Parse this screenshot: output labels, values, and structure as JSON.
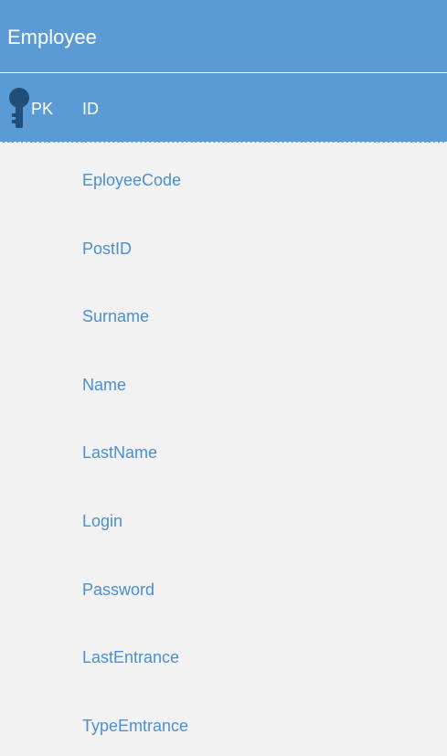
{
  "entity": {
    "title": "Employee",
    "primary_key": {
      "badge": "PK",
      "field": "ID",
      "icon": "key-icon"
    },
    "attributes": [
      "EployeeCode",
      "PostID",
      "Surname",
      "Name",
      "LastName",
      "Login",
      "Password",
      "LastEntrance",
      "TypeEmtrance"
    ]
  },
  "colors": {
    "header_bg": "#5b9bd5",
    "body_bg": "#f2f2f2",
    "attribute_text": "#4a8fd0",
    "header_text": "#ffffff",
    "key_icon": "#1f4e79"
  }
}
